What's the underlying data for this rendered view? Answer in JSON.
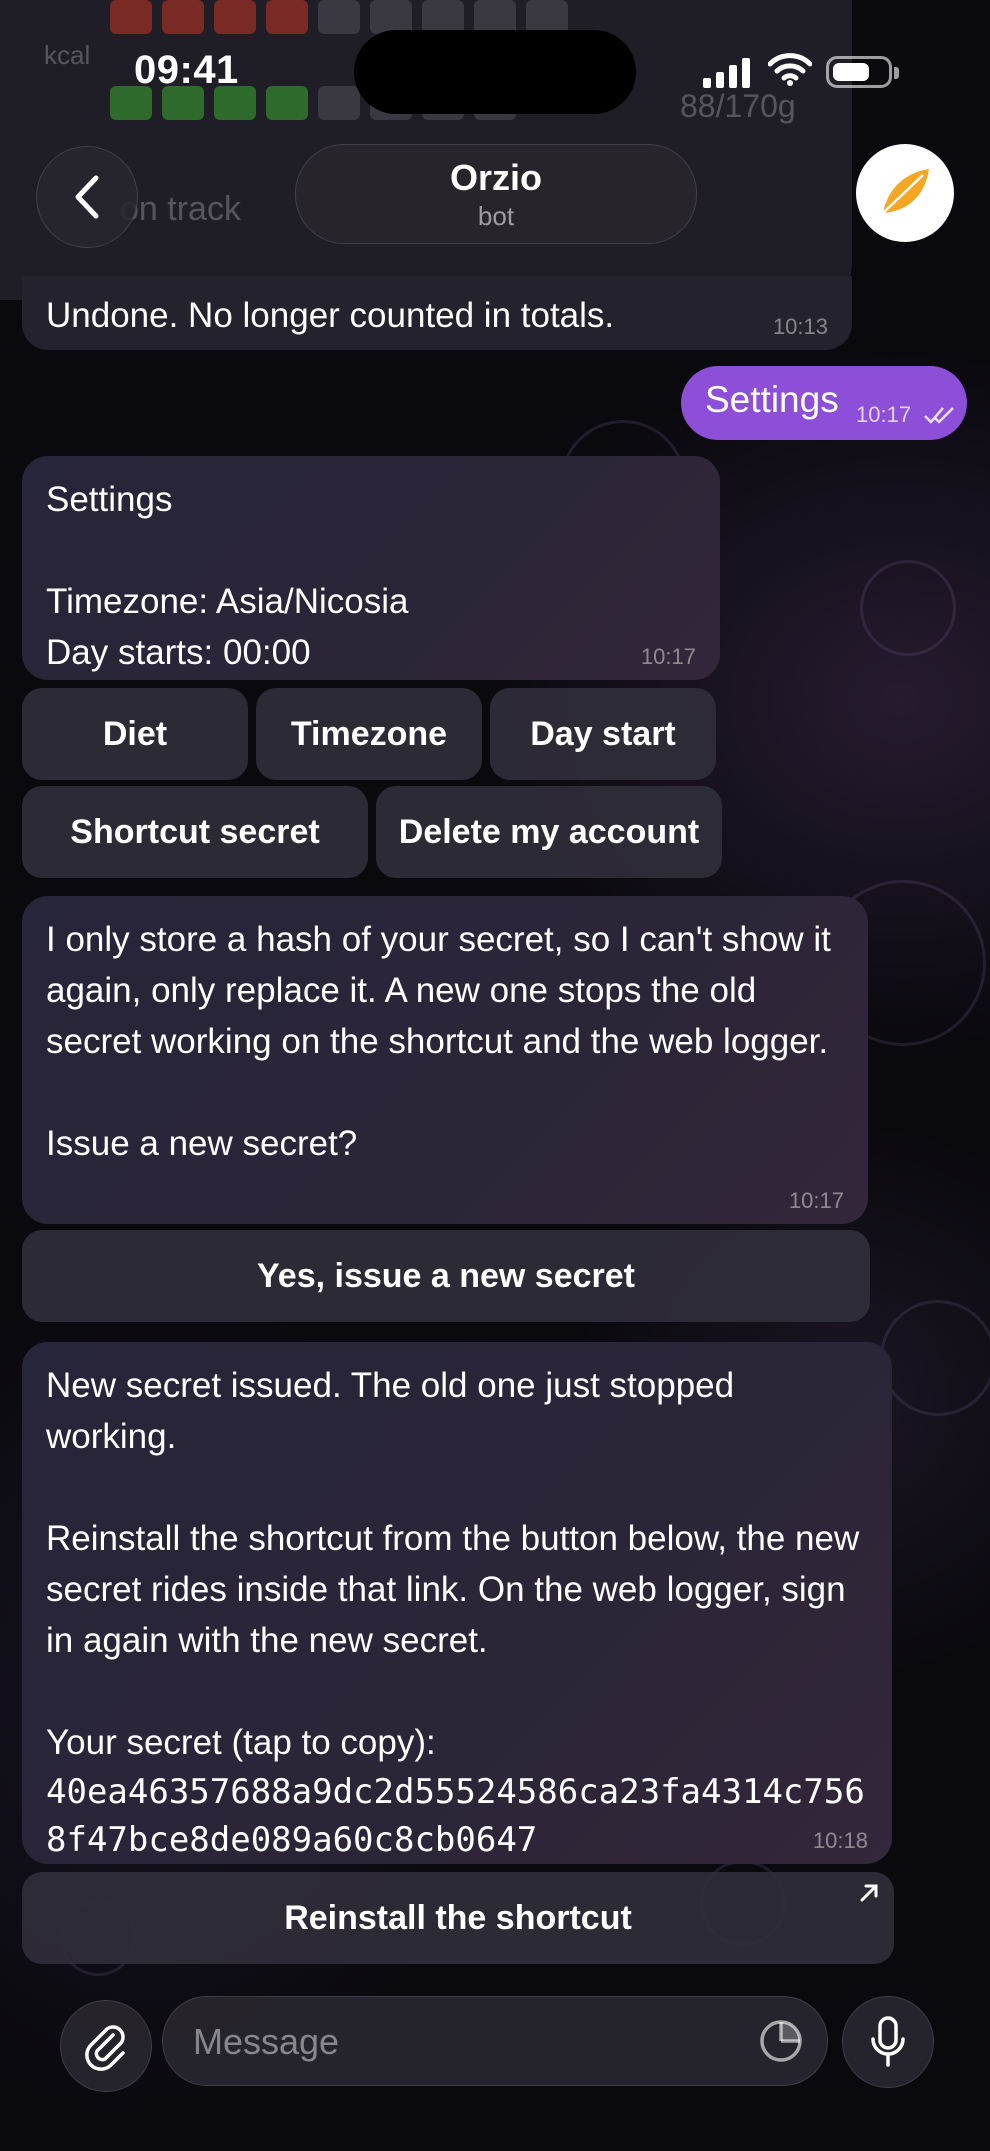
{
  "status_bar": {
    "time": "09:41"
  },
  "header": {
    "title": "Orzio",
    "subtitle": "bot"
  },
  "ghost": {
    "kcal_label": "kcal",
    "protein_value": "88/170g",
    "on_track": "on track"
  },
  "messages": [
    {
      "text": "Undone. No longer counted in totals.",
      "time": "10:13"
    },
    {
      "text": "Settings",
      "time": "10:17"
    },
    {
      "text": "Settings\n\nTimezone: Asia/Nicosia\nDay starts: 00:00",
      "time": "10:17"
    },
    {
      "text": "I only store a hash of your secret, so I can't show it again, only replace it. A new one stops the old secret working on the shortcut and the web logger.\n\nIssue a new secret?",
      "time": "10:17"
    },
    {
      "text": "New secret issued. The old one just stopped working.\n\nReinstall the shortcut from the button below, the new secret rides inside that link. On the web logger, sign in again with the new secret.\n\nYour secret (tap to copy):",
      "secret": "40ea46357688a9dc2d55524586ca23fa4314c7568f47bce8de089a60c8cb0647",
      "time": "10:18"
    }
  ],
  "settings_buttons": {
    "diet": "Diet",
    "timezone": "Timezone",
    "day_start": "Day start",
    "shortcut_secret": "Shortcut secret",
    "delete_account": "Delete my account"
  },
  "confirm_button": "Yes, issue a new secret",
  "reinstall_button": "Reinstall the shortcut",
  "composer": {
    "placeholder": "Message"
  }
}
